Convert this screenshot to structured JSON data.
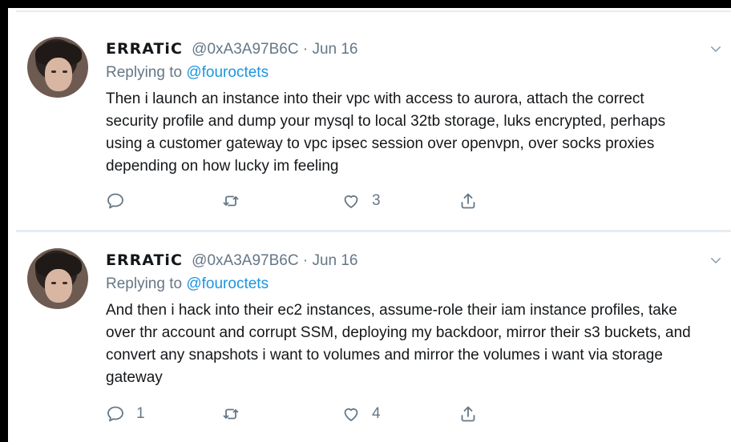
{
  "tweets": [
    {
      "display_name": "ERRATiC",
      "handle": "@0xA3A97B6C",
      "date": "Jun 16",
      "replying_prefix": "Replying to",
      "replying_to": "@fouroctets",
      "text": "Then i launch an instance into their vpc with access to aurora, attach the correct security profile and dump your mysql to local 32tb storage, luks encrypted, perhaps using a customer gateway to vpc ipsec session over openvpn, over socks proxies depending on how lucky im feeling",
      "reply_count": "",
      "retweet_count": "",
      "like_count": "3"
    },
    {
      "display_name": "ERRATiC",
      "handle": "@0xA3A97B6C",
      "date": "Jun 16",
      "replying_prefix": "Replying to",
      "replying_to": "@fouroctets",
      "text": "And then i hack into their ec2 instances, assume-role their iam instance profiles, take over thr account and corrupt SSM, deploying my backdoor, mirror their s3 buckets, and convert any snapshots i want to volumes and mirror the volumes i want via storage gateway",
      "reply_count": "1",
      "retweet_count": "",
      "like_count": "4"
    }
  ],
  "separator": "·",
  "icons": {
    "reply": "comment-bubble-icon",
    "retweet": "retweet-icon",
    "like": "heart-icon",
    "share": "share-icon",
    "menu": "chevron-down-icon"
  },
  "colors": {
    "text": "#14171a",
    "muted": "#657786",
    "link": "#1b95e0",
    "divider": "#e6ecf0",
    "frame": "#000000"
  }
}
